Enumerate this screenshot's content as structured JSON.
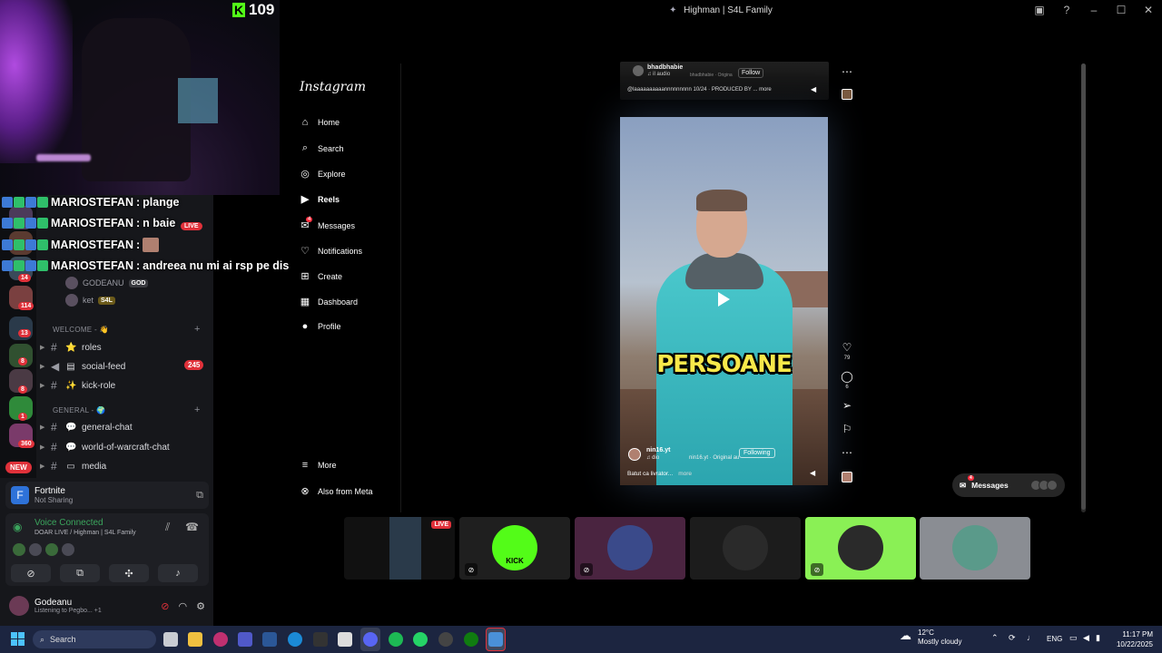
{
  "kick": {
    "count": "109"
  },
  "window": {
    "title": "Highman | S4L Family"
  },
  "chat": [
    {
      "user": "MARIOSTEFAN",
      "sep": " : ",
      "text": "plange"
    },
    {
      "user": "MARIOSTEFAN",
      "sep": " : ",
      "text": "n baie"
    },
    {
      "user": "MARIOSTEFAN",
      "sep": " : ",
      "text": ""
    },
    {
      "user": "MARIOSTEFAN",
      "sep": " : ",
      "text": "andreea nu mi ai rsp pe dis"
    }
  ],
  "discord": {
    "live_badge": "LIVE",
    "server_badges": [
      "14",
      "114",
      "13",
      "8",
      "8",
      "1",
      "360"
    ],
    "new_badge": "NEW",
    "members": [
      {
        "name": "GODEANU",
        "tag": "GOD"
      },
      {
        "name": "ket",
        "tag": "S4L"
      }
    ],
    "categories": {
      "welcome": "WELCOME - 👋",
      "general": "GENERAL - 🌍"
    },
    "channels": [
      {
        "name": "roles",
        "emoji": "⭐"
      },
      {
        "name": "social-feed",
        "emoji": "▤",
        "unread": "245"
      },
      {
        "name": "kick-role",
        "emoji": "✨"
      },
      {
        "name": "general-chat",
        "emoji": "💬"
      },
      {
        "name": "world-of-warcraft-chat",
        "emoji": "💬"
      },
      {
        "name": "media",
        "emoji": "▭"
      }
    ],
    "activity": {
      "game": "Fortnite",
      "status": "Not Sharing"
    },
    "voice": {
      "title": "Voice Connected",
      "channel": "DOAR LIVE / Highman | S4L Family"
    },
    "user": {
      "name": "Godeanu",
      "status": "Listening to Pegbo... +1"
    }
  },
  "instagram": {
    "logo": "Instagram",
    "nav": [
      {
        "label": "Home",
        "icon": "⌂"
      },
      {
        "label": "Search",
        "icon": "⌕"
      },
      {
        "label": "Explore",
        "icon": "◎"
      },
      {
        "label": "Reels",
        "icon": "▶"
      },
      {
        "label": "Messages",
        "icon": "✉",
        "badge": "4"
      },
      {
        "label": "Notifications",
        "icon": "♡"
      },
      {
        "label": "Create",
        "icon": "⊞"
      },
      {
        "label": "Dashboard",
        "icon": "▦"
      },
      {
        "label": "Profile",
        "icon": "●"
      }
    ],
    "more": {
      "label": "More",
      "icon": "≡"
    },
    "meta": {
      "label": "Also from Meta",
      "icon": "⊗"
    },
    "prev_reel": {
      "user": "bhadbhabie",
      "audio": "♫ il audio",
      "original": "bhadbhabie · Origina",
      "follow": "Follow",
      "caption": "@laaaaaaaaaannnnnnnnn 10/24 · PRODUCED BY ... more"
    },
    "reel": {
      "caption_overlay": "PERSOANE",
      "owner": "nin16.yt",
      "audio": "♫ dio",
      "original": "nin16.yt · Original au",
      "following": "Following",
      "description": "Batut ca livrator...",
      "more": "more",
      "likes": "79",
      "comments": "6"
    },
    "messages_pill": {
      "label": "Messages",
      "count": "4"
    }
  },
  "tiles": [
    {
      "label": "LIVE",
      "bg": "#111111"
    },
    {
      "label": "KICK",
      "bg": "#1f1f1f"
    },
    {
      "label": "",
      "bg": "#4a2440"
    },
    {
      "label": "",
      "bg": "#1c1c1c"
    },
    {
      "label": "",
      "bg": "#8af055"
    },
    {
      "label": "",
      "bg": "#8a8d93"
    }
  ],
  "taskbar": {
    "search": "Search",
    "weather_temp": "12°C",
    "weather_desc": "Mostly cloudy",
    "lang": "ENG",
    "time": "11:17 PM",
    "date": "10/22/2025"
  }
}
